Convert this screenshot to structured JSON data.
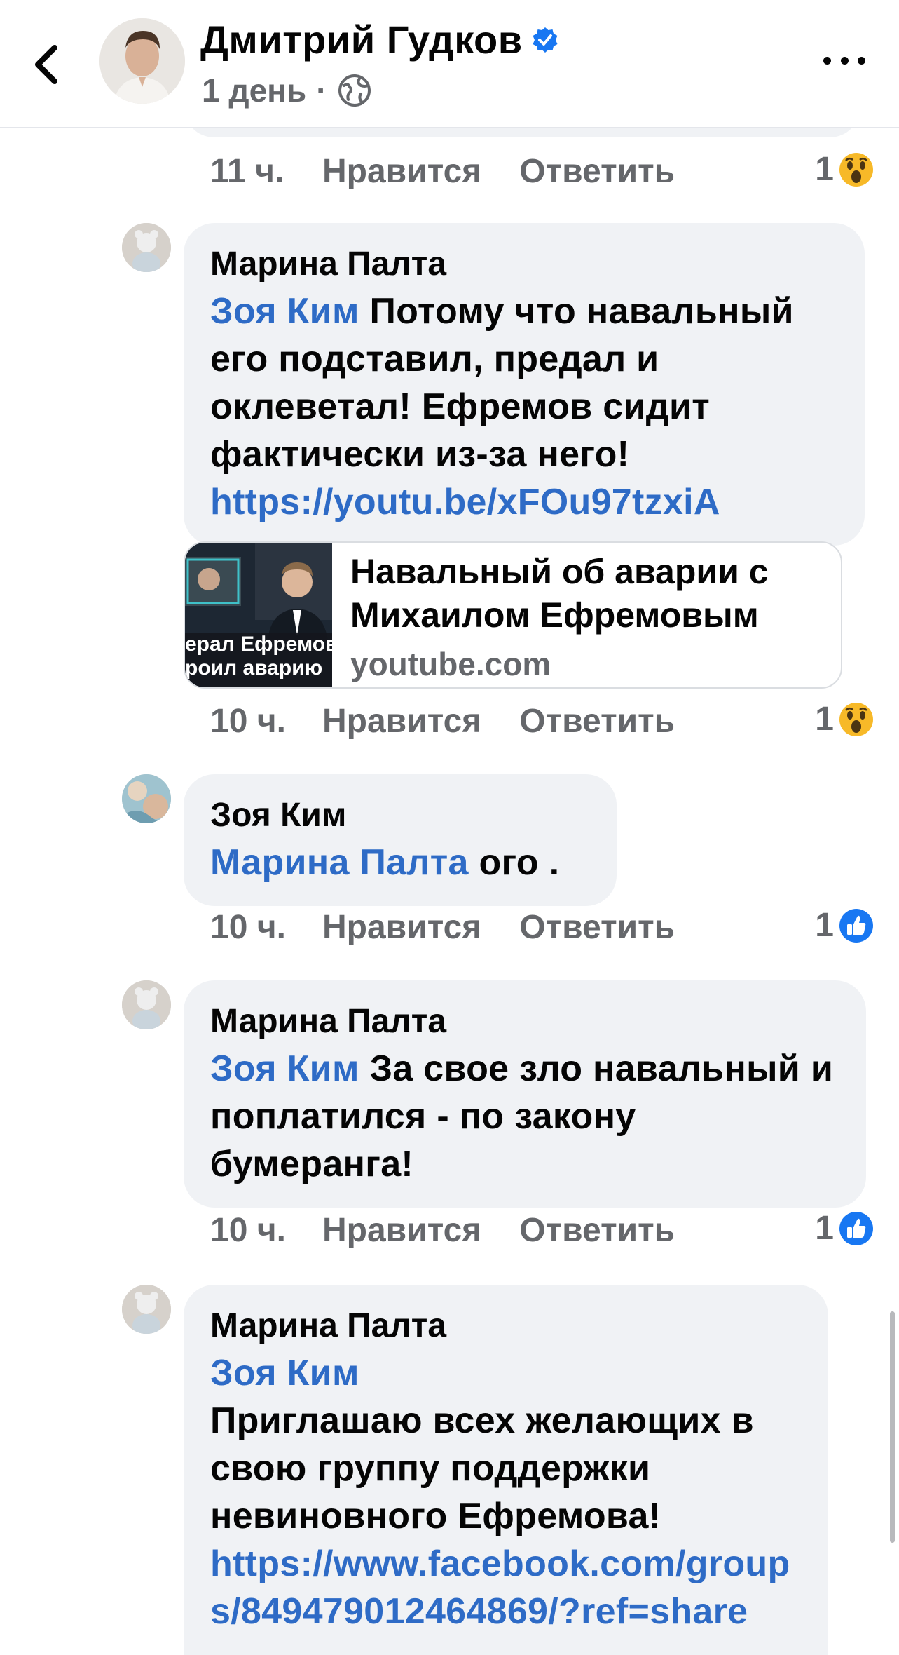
{
  "header": {
    "author": "Дмитрий Гудков",
    "time": "1 день",
    "dot": "·",
    "icons": {
      "back": "chevron-left-icon",
      "verified": "verified-badge-icon",
      "audience": "globe-icon",
      "more": "more-dots-icon"
    }
  },
  "colors": {
    "mention": "#2e6bc6",
    "bubble": "#f0f2f5",
    "meta": "#65676b",
    "like_blue": "#1877f2",
    "wow_yellow": "#f7b928"
  },
  "comments": [
    {
      "actions": {
        "time": "11 ч.",
        "like": "Нравится",
        "reply": "Ответить",
        "reaction_count": "1",
        "reaction": "wow-reaction-icon"
      }
    },
    {
      "author": "Марина Палта",
      "mention": "Зоя Ким",
      "text": " Потому что навальный его подставил, предал и оклеветал! Ефремов сидит фактически из-за него!",
      "link": "https://youtu.be/xFOu97tzxiA",
      "preview": {
        "title": "Навальный об аварии с Михаилом Ефремовым",
        "domain": "youtube.com",
        "thumb_caption": "ерал Ефремов\nроил аварию"
      },
      "actions": {
        "time": "10 ч.",
        "like": "Нравится",
        "reply": "Ответить",
        "reaction_count": "1",
        "reaction": "wow-reaction-icon"
      }
    },
    {
      "author": "Зоя Ким",
      "mention": "Марина Палта",
      "text": " ого .",
      "actions": {
        "time": "10 ч.",
        "like": "Нравится",
        "reply": "Ответить",
        "reaction_count": "1",
        "reaction": "like-reaction-icon"
      }
    },
    {
      "author": "Марина Палта",
      "mention": "Зоя Ким",
      "text": " За свое зло навальный и поплатился - по закону бумеранга!",
      "actions": {
        "time": "10 ч.",
        "like": "Нравится",
        "reply": "Ответить",
        "reaction_count": "1",
        "reaction": "like-reaction-icon"
      }
    },
    {
      "author": "Марина Палта",
      "mention": "Зоя Ким",
      "text": "Приглашаю всех желающих в свою группу поддержки невиновного Ефремова!",
      "link": "https://www.facebook.com/groups/849479012464869/?ref=share"
    }
  ]
}
